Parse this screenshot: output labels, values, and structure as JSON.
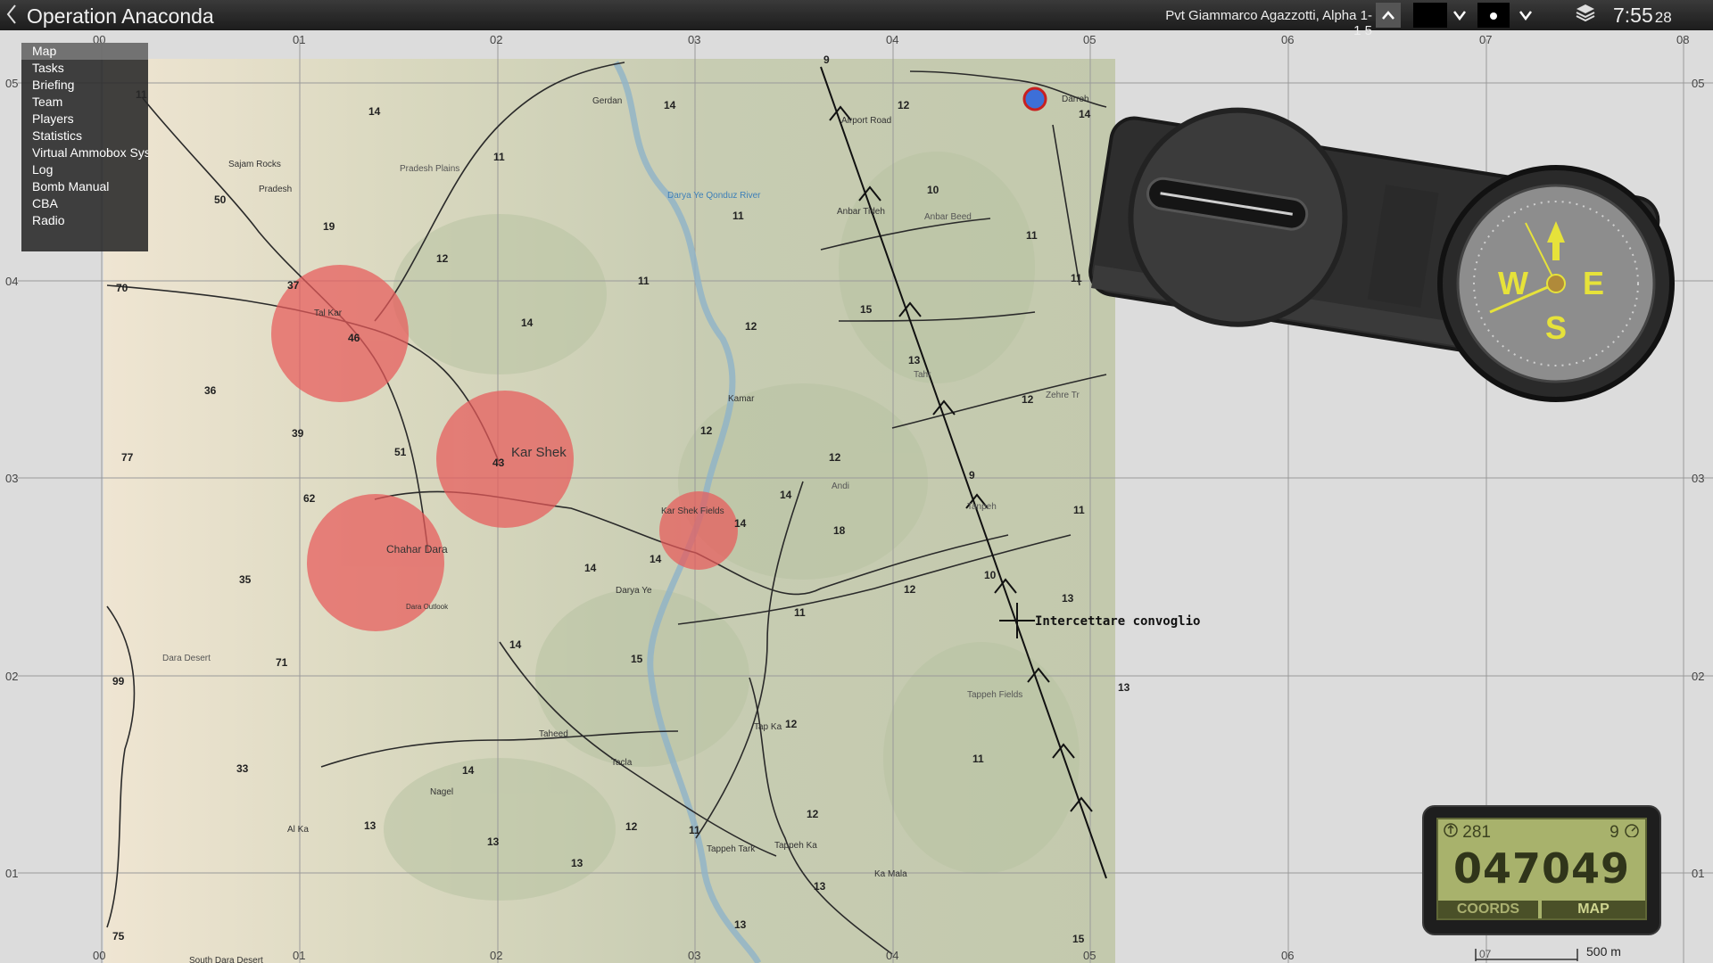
{
  "header": {
    "back_icon": "chevron-left-icon",
    "title": "Operation Anaconda",
    "player": "Pvt Giammarco Agazzotti, Alpha 1-1 5",
    "time": "7:55",
    "time_seconds": "28"
  },
  "menu": {
    "items": [
      {
        "label": "Map",
        "active": true
      },
      {
        "label": "Tasks"
      },
      {
        "label": "Briefing"
      },
      {
        "label": "Team"
      },
      {
        "label": "Players"
      },
      {
        "label": "Statistics"
      },
      {
        "label": "Virtual Ammobox System"
      },
      {
        "label": "Log"
      },
      {
        "label": "Bomb Manual"
      },
      {
        "label": "CBA"
      },
      {
        "label": "Radio"
      }
    ]
  },
  "grid": {
    "x_labels": [
      "00",
      "01",
      "02",
      "03",
      "04",
      "05",
      "06",
      "07",
      "08"
    ],
    "y_labels": [
      "05",
      "04",
      "03",
      "02",
      "01"
    ]
  },
  "map": {
    "locations": [
      "Gerdan",
      "Darreh",
      "Sajam Rocks",
      "Pradesh",
      "Pradesh Plains",
      "Darya Ye Qonduz River",
      "Airport Road",
      "Anbar Tideh",
      "Anbar Beed",
      "Tal Kar",
      "Kamar",
      "Kar Shek",
      "Tahr",
      "Andi",
      "Zehre Tr",
      "Kar Shek Fields",
      "Tanpeh",
      "Chahar Dara",
      "Dara Outlook",
      "Darya Ye",
      "Dara Desert",
      "Tappeh Fields",
      "Tap Ka",
      "Taheed",
      "Nagel",
      "Tacla",
      "Al Ka",
      "Tappeh Tark",
      "Tappeh Ka",
      "Ka Mala",
      "South Dara Desert"
    ],
    "elevations": [
      "11",
      "14",
      "14",
      "12",
      "9",
      "14",
      "11",
      "50",
      "19",
      "12",
      "10",
      "11",
      "11",
      "70",
      "37",
      "11",
      "11",
      "46",
      "14",
      "12",
      "15",
      "36",
      "13",
      "39",
      "51",
      "12",
      "12",
      "77",
      "43",
      "9",
      "12",
      "62",
      "14",
      "14",
      "11",
      "18",
      "14",
      "14",
      "10",
      "35",
      "12",
      "13",
      "11",
      "71",
      "14",
      "15",
      "13",
      "99",
      "12",
      "11",
      "33",
      "14",
      "13",
      "13",
      "12",
      "11",
      "12",
      "13",
      "13",
      "13",
      "75",
      "15"
    ],
    "task_label": "Intercettare convoglio"
  },
  "compass": {
    "letters": [
      "W",
      "E",
      "S"
    ],
    "icon": "compass-icon"
  },
  "gps": {
    "heading": "281",
    "speed": "9",
    "coords": "047049",
    "tab_coords": "COORDS",
    "tab_map": "MAP"
  },
  "scale": {
    "label": "500 m",
    "tick": "07"
  },
  "colors": {
    "danger_zone": "#e85a5a",
    "route": "#1a1a1a",
    "gps_screen": "#a8b26c"
  }
}
